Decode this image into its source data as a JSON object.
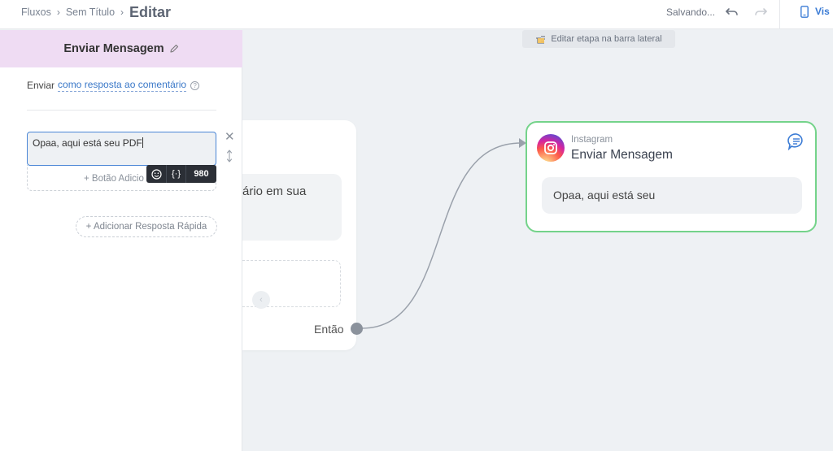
{
  "breadcrumb": {
    "root": "Fluxos",
    "middle": "Sem Título",
    "current": "Editar"
  },
  "topbar": {
    "status": "Salvando...",
    "view_label": "Vis"
  },
  "sidebar": {
    "title": "Enviar Mensagem",
    "send_prefix": "Enviar",
    "send_link": "como resposta ao comentário",
    "message_value": "Opaa, aqui está seu PDF",
    "char_count": "980",
    "vars_symbol": "{·}",
    "add_button_label": "+ Botão Adicio",
    "quick_reply_label": "+ Adicionar Resposta Rápida"
  },
  "canvas": {
    "hint": "Editar etapa na barra lateral",
    "left_card": {
      "message_fragment": "ário em sua",
      "then_label": "Então"
    },
    "ig_card": {
      "platform": "Instagram",
      "title": "Enviar Mensagem",
      "message": "Opaa, aqui está seu"
    }
  },
  "colors": {
    "accent": "#3a7bd5",
    "sidebar_header": "#efdcf3",
    "success_border": "#74d38a",
    "toolbar_dark": "#2b2f36"
  }
}
